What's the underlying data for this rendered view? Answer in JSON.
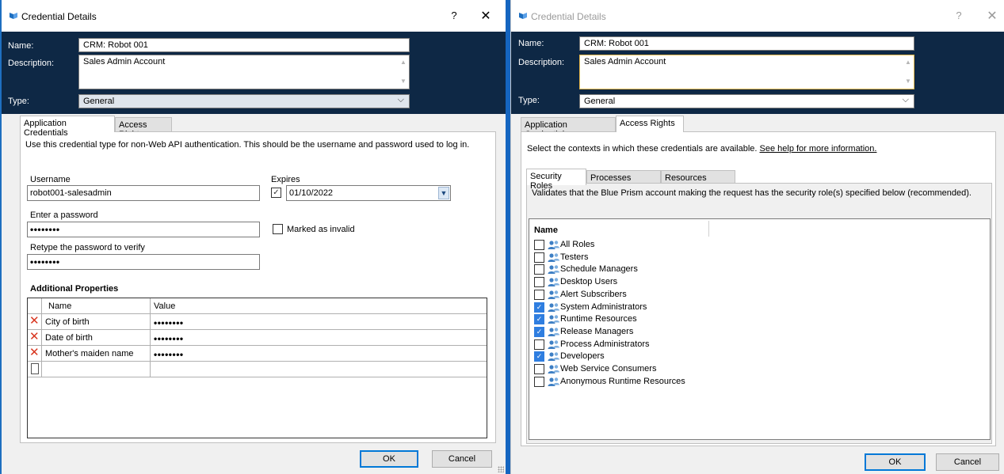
{
  "left_dialog": {
    "title": "Credential Details",
    "help_glyph": "?",
    "close_glyph": "✕",
    "name_label": "Name:",
    "name_value": "CRM: Robot 001",
    "description_label": "Description:",
    "description_value": "Sales Admin Account",
    "type_label": "Type:",
    "type_value": "General",
    "tabs": [
      {
        "label": "Application Credentials",
        "active": true
      },
      {
        "label": "Access Rights",
        "active": false
      }
    ],
    "intro_text": "Use this credential type for non-Web API authentication. This should be the username and password used to log in.",
    "username_label": "Username",
    "username_value": "robot001-salesadmin",
    "expires_label": "Expires",
    "expires_checked": true,
    "expires_value": "01/10/2022",
    "password_label": "Enter a password",
    "password_value": "••••••••",
    "marked_invalid_label": "Marked as invalid",
    "marked_invalid_checked": false,
    "retype_label": "Retype the password to verify",
    "retype_value": "••••••••",
    "additional_properties_label": "Additional Properties",
    "grid_columns": [
      "Name",
      "Value"
    ],
    "grid_rows": [
      {
        "name": "City of birth",
        "value": "••••••••"
      },
      {
        "name": "Date of birth",
        "value": "••••••••"
      },
      {
        "name": "Mother's maiden name",
        "value": "••••••••"
      }
    ],
    "ok_label": "OK",
    "cancel_label": "Cancel"
  },
  "right_dialog": {
    "title": "Credential Details",
    "help_glyph": "?",
    "close_glyph": "✕",
    "name_label": "Name:",
    "name_value": "CRM: Robot 001",
    "description_label": "Description:",
    "description_value": "Sales Admin Account",
    "type_label": "Type:",
    "type_value": "General",
    "tabs": [
      {
        "label": "Application Credentials",
        "active": false
      },
      {
        "label": "Access Rights",
        "active": true
      }
    ],
    "intro_text": "Select the contexts in which these credentials are available.",
    "help_link": "See help for more information.",
    "sub_tabs": [
      {
        "label": "Security Roles",
        "active": true
      },
      {
        "label": "Processes (legacy)",
        "active": false
      },
      {
        "label": "Resources (legacy)",
        "active": false
      }
    ],
    "roles_intro": "Validates that the Blue Prism account making the request has the security role(s) specified below (recommended).",
    "list_header": "Name",
    "roles": [
      {
        "label": "All Roles",
        "checked": false
      },
      {
        "label": "Testers",
        "checked": false
      },
      {
        "label": "Schedule Managers",
        "checked": false
      },
      {
        "label": "Desktop Users",
        "checked": false
      },
      {
        "label": "Alert Subscribers",
        "checked": false
      },
      {
        "label": "System Administrators",
        "checked": true
      },
      {
        "label": "Runtime Resources",
        "checked": true
      },
      {
        "label": "Release Managers",
        "checked": true
      },
      {
        "label": "Process Administrators",
        "checked": false
      },
      {
        "label": "Developers",
        "checked": true
      },
      {
        "label": "Web Service Consumers",
        "checked": false
      },
      {
        "label": "Anonymous Runtime Resources",
        "checked": false
      }
    ],
    "ok_label": "OK",
    "cancel_label": "Cancel"
  },
  "colors": {
    "header_band": "#0e2845",
    "window_border_active": "#1e6fc0",
    "delete_icon": "#d8351f",
    "checkbox_checked": "#2f7ee0"
  }
}
